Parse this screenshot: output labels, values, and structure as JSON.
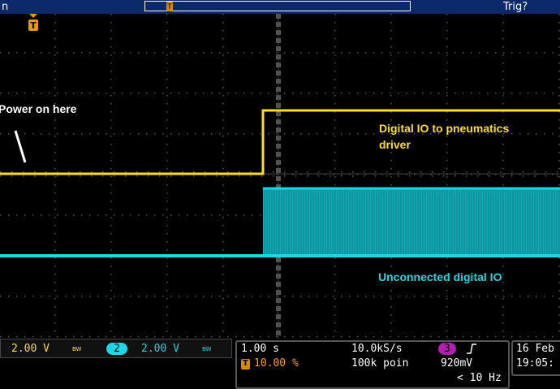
{
  "topbar": {
    "left_text": "n",
    "right_text": "Trig?"
  },
  "trigger_marker": {
    "label": "T"
  },
  "annotations": {
    "power_note": "Power on here",
    "yellow_line1": "Digital IO to pneumatics",
    "yellow_line2": "driver",
    "cyan_note": "Unconnected digital IO"
  },
  "channels": [
    {
      "scale": "2.00 V",
      "bw": "BW",
      "color": "#ffde20"
    },
    {
      "number": "2",
      "scale": "2.00 V",
      "bw": "BW",
      "color": "#1ad8e6"
    }
  ],
  "timebase": {
    "scale": "1.00 s",
    "trigger_pos_icon": "T",
    "trigger_pos": "10.00 %",
    "sample_rate": "10.0kS/s",
    "record_length": "100k poin"
  },
  "trigger": {
    "source": "3",
    "slope_icon": "rising-edge",
    "level": "920mV",
    "freq": "< 10 Hz",
    "source_color": "#b020b0"
  },
  "datetime": {
    "date": "16 Feb",
    "time": "19:05:"
  },
  "colors": {
    "ch1": "#ffde20",
    "ch2": "#1ad8e6",
    "topbar": "#0c2a6a",
    "grid": "#555555"
  }
}
